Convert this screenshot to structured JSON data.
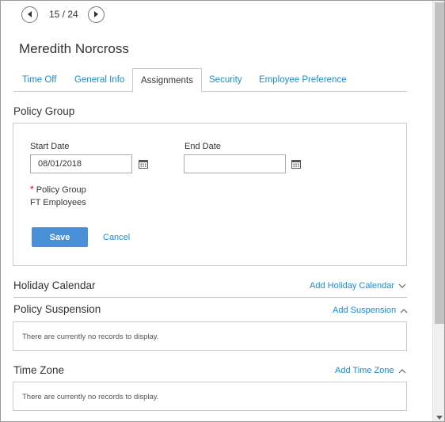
{
  "pager": {
    "text": "15 / 24"
  },
  "employee": {
    "name": "Meredith Norcross"
  },
  "tabs": [
    {
      "label": "Time Off"
    },
    {
      "label": "General Info"
    },
    {
      "label": "Assignments"
    },
    {
      "label": "Security"
    },
    {
      "label": "Employee Preference"
    }
  ],
  "policy_group": {
    "title": "Policy Group",
    "start_date_label": "Start Date",
    "start_date_value": "08/01/2018",
    "end_date_label": "End Date",
    "end_date_value": "",
    "required_mark": "*",
    "policy_group_label": "Policy Group",
    "policy_group_value": "FT Employees",
    "save_label": "Save",
    "cancel_label": "Cancel"
  },
  "holiday_calendar": {
    "title": "Holiday Calendar",
    "add_label": "Add Holiday Calendar"
  },
  "policy_suspension": {
    "title": "Policy Suspension",
    "add_label": "Add Suspension",
    "empty_text": "There are currently no records to display."
  },
  "time_zone": {
    "title": "Time Zone",
    "add_label": "Add Time Zone",
    "empty_text": "There are currently no records to display."
  },
  "colors": {
    "link": "#1a8cd8",
    "primary_button": "#4a90d9",
    "required": "#d0021b"
  }
}
